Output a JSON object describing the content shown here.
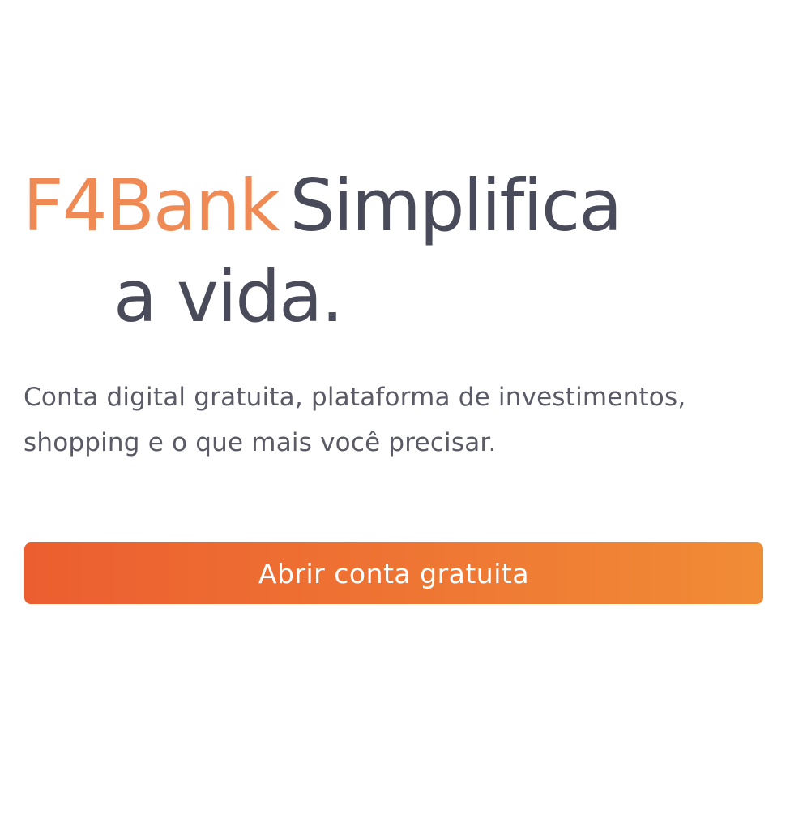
{
  "hero": {
    "brand": "F4Bank",
    "headline_part1": "Simplifica",
    "headline_part2": "a vida.",
    "subtitle_line1": "Conta digital gratuita, plataforma de investimentos,",
    "subtitle_line2": "shopping e o que mais você precisar.",
    "cta_label": "Abrir conta gratuita"
  },
  "colors": {
    "brand": "#f08a55",
    "headline": "#4a4b5a",
    "subtitle": "#5a5b66",
    "cta_gradient_start": "#ec5e30",
    "cta_gradient_end": "#f18c36",
    "cta_text": "#ffffff"
  }
}
